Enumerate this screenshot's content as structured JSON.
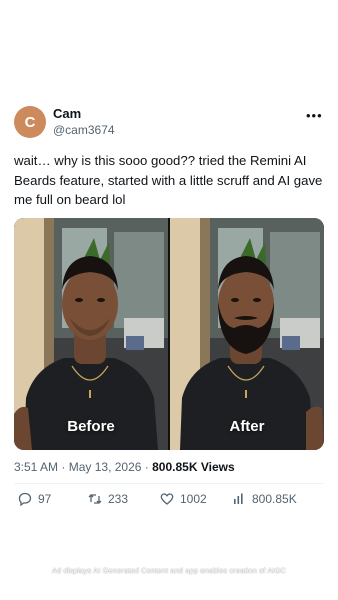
{
  "author": {
    "avatar_letter": "C",
    "avatar_color": "#cd8a5c",
    "name": "Cam",
    "handle": "@cam3674"
  },
  "more_menu": "•••",
  "tweet_text": "wait… why is this sooo good?? tried the Remini AI Beards feature, started with a little scruff and AI gave me full on beard lol",
  "media": {
    "before_label": "Before",
    "after_label": "After"
  },
  "meta": {
    "time": "3:51 AM",
    "separator": "·",
    "date": "May 13, 2026",
    "views": "800.85K Views"
  },
  "actions": {
    "replies": "97",
    "reposts": "233",
    "likes": "1002",
    "views": "800.85K"
  },
  "disclaimer": "Ad displays AI Generated Content and app enables creation of AIGC"
}
